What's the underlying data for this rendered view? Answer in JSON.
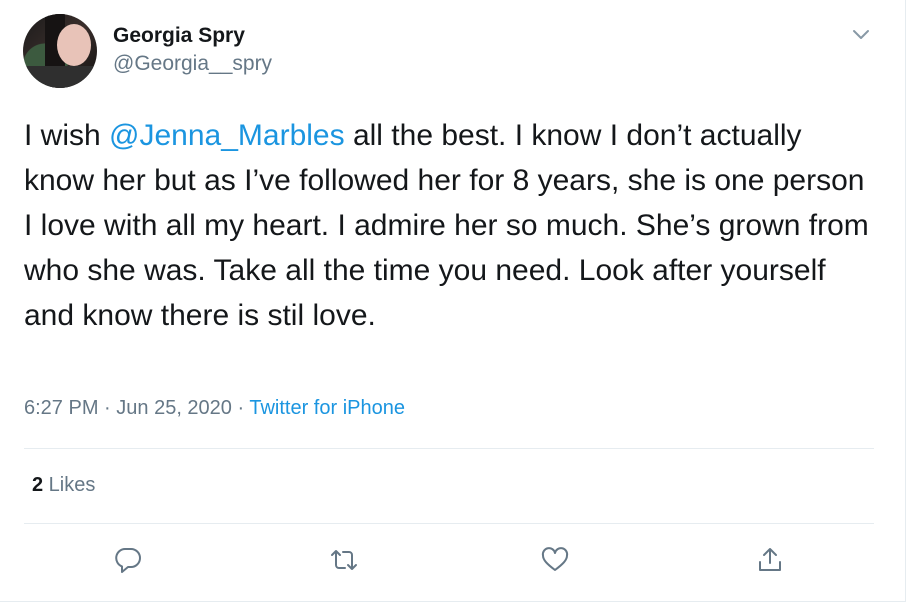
{
  "author": {
    "name": "Georgia Spry",
    "handle": "@Georgia__spry"
  },
  "tweet": {
    "text_before": "I wish ",
    "mention": "@Jenna_Marbles",
    "text_after": " all the best. I know I don’t actually know her but as I’ve followed her for 8 years, she is one person I love with all my heart. I admire her so much. She’s grown from who she was. Take all the time you need. Look after yourself and know there is stil love.",
    "time": "6:27 PM",
    "separator": " · ",
    "date": "Jun 25, 2020",
    "source": "Twitter for iPhone"
  },
  "stats": {
    "likes_count": "2",
    "likes_label": " Likes"
  },
  "icons": {
    "menu": "chevron-down-icon",
    "reply": "reply-icon",
    "retweet": "retweet-icon",
    "like": "heart-icon",
    "share": "share-icon"
  },
  "colors": {
    "accent": "#1b95e0",
    "secondary_text": "#657786",
    "icon": "#657786",
    "border": "#e6ecf0"
  }
}
